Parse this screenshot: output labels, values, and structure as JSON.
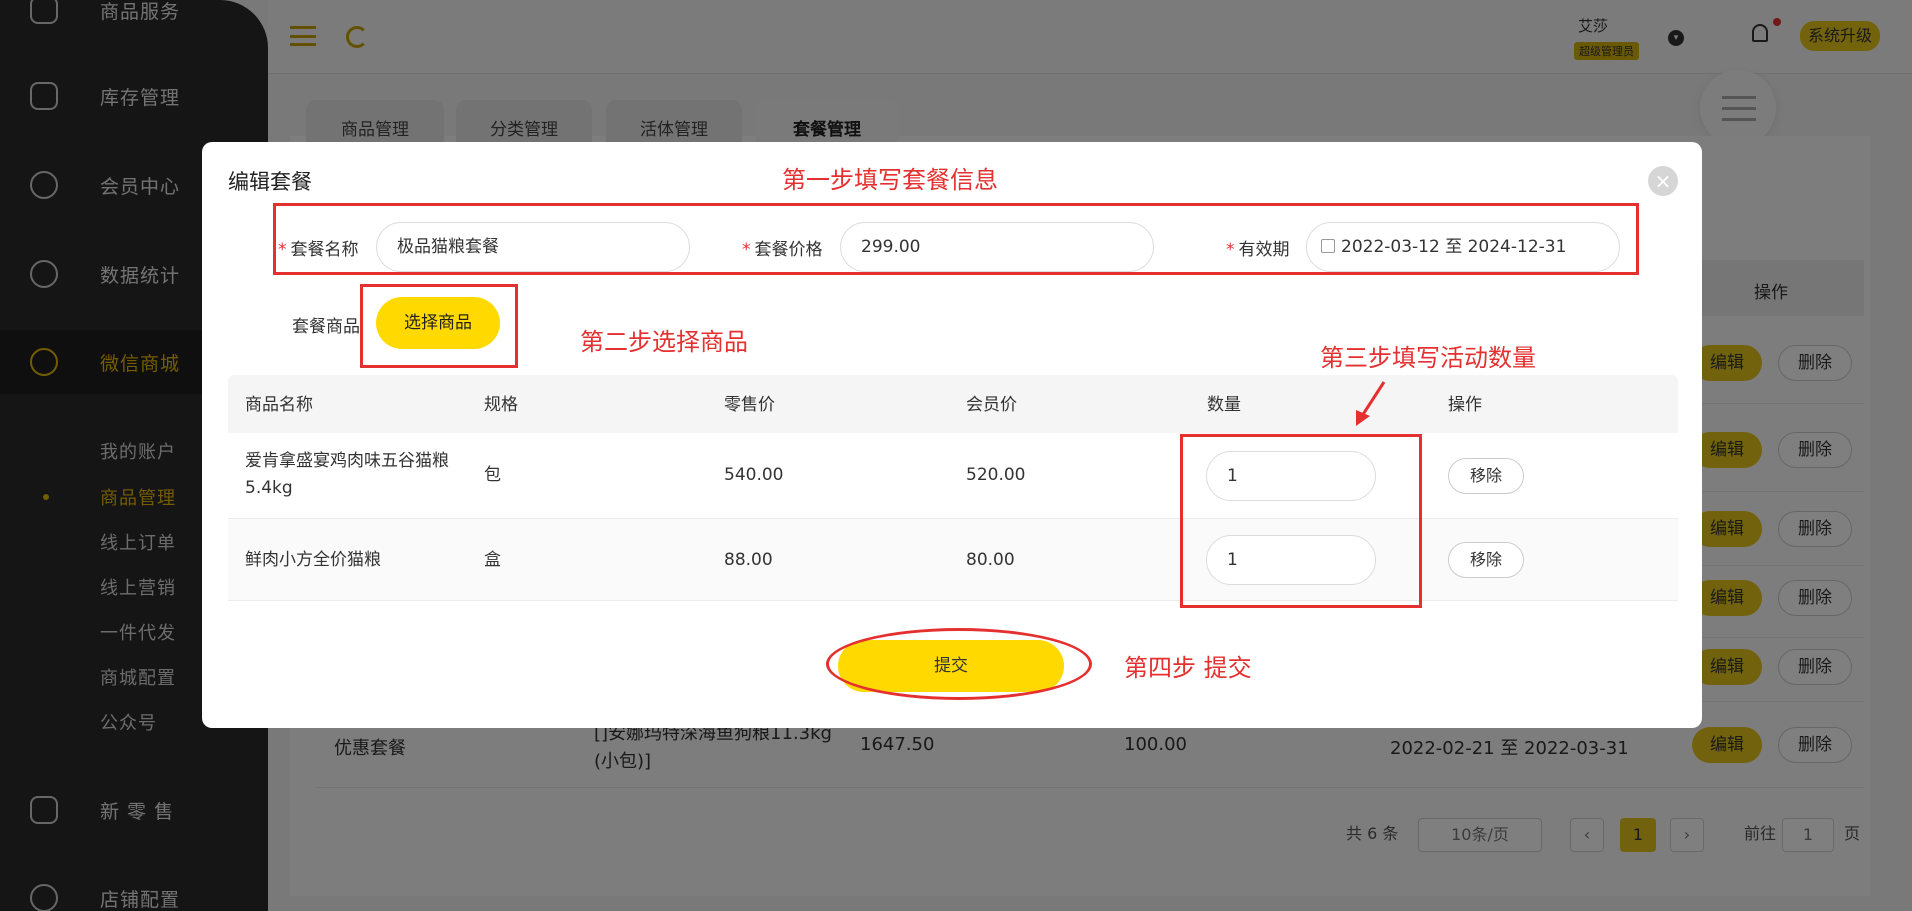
{
  "sidebar": {
    "items": [
      {
        "label": "商品服务",
        "icon": "bag-icon"
      },
      {
        "label": "库存管理",
        "icon": "archive-icon"
      },
      {
        "label": "会员中心",
        "icon": "member-icon"
      },
      {
        "label": "数据统计",
        "icon": "chart-icon"
      },
      {
        "label": "微信商城",
        "icon": "wechat-icon"
      },
      {
        "label": "新 零 售",
        "icon": "cube-icon"
      },
      {
        "label": "店铺配置",
        "icon": "settings-icon"
      }
    ],
    "subitems": [
      "我的账户",
      "商品管理",
      "线上订单",
      "线上营销",
      "一件代发",
      "商城配置",
      "公众号"
    ]
  },
  "header": {
    "user_name": "艾莎",
    "user_role": "超级管理员",
    "upgrade_label": "系统升级"
  },
  "tabs": [
    "商品管理",
    "分类管理",
    "活体管理",
    "套餐管理"
  ],
  "bg_table": {
    "op_header": "操作",
    "edit_label": "编辑",
    "delete_label": "删除",
    "last_row": {
      "name": "优惠套餐",
      "goods": "[]安娜玛特深海鱼狗粮11.3kg (小包)]",
      "price": "1647.50",
      "member_price": "100.00",
      "validity": "2022-02-21 至 2022-03-31"
    }
  },
  "pagination": {
    "total": "共 6 条",
    "page_size": "10条/页",
    "current": "1",
    "goto_label": "前往",
    "goto_value": "1",
    "page_suffix": "页"
  },
  "modal": {
    "title": "编辑套餐",
    "fields": {
      "name_label": "套餐名称",
      "name_value": "极品猫粮套餐",
      "price_label": "套餐价格",
      "price_value": "299.00",
      "validity_label": "有效期",
      "validity_value": "2022-03-12 至 2024-12-31"
    },
    "goods_label": "套餐商品",
    "select_button": "选择商品",
    "table": {
      "headers": [
        "商品名称",
        "规格",
        "零售价",
        "会员价",
        "数量",
        "操作"
      ],
      "rows": [
        {
          "name": "爱肯拿盛宴鸡肉味五谷猫粮5.4kg",
          "spec": "包",
          "retail": "540.00",
          "member": "520.00",
          "qty": "1",
          "action": "移除"
        },
        {
          "name": "鲜肉小方全价猫粮",
          "spec": "盒",
          "retail": "88.00",
          "member": "80.00",
          "qty": "1",
          "action": "移除"
        }
      ]
    },
    "submit_label": "提交"
  },
  "annotations": {
    "step1": "第一步填写套餐信息",
    "step2": "第二步选择商品",
    "step3": "第三步填写活动数量",
    "step4": "第四步 提交",
    "color": "#e53030"
  }
}
